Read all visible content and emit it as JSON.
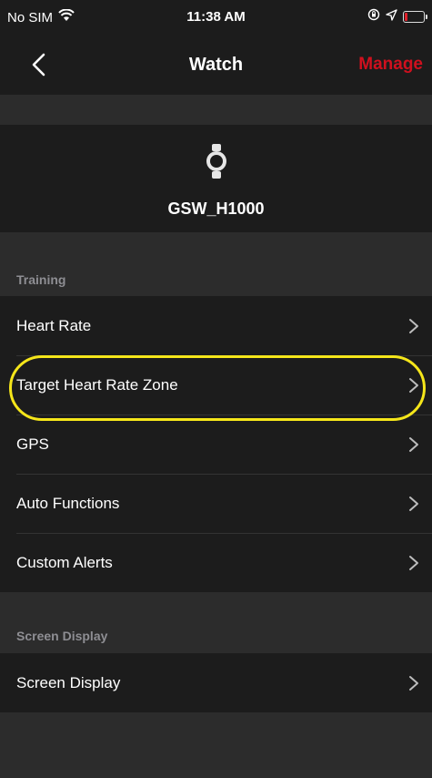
{
  "status_bar": {
    "carrier": "No SIM",
    "time": "11:38 AM",
    "icons": [
      "wifi-icon",
      "orientation-lock-icon",
      "location-arrow-icon",
      "battery-icon"
    ],
    "battery_color": "#e0202a"
  },
  "nav": {
    "back_icon": "chevron-left-icon",
    "title": "Watch",
    "manage_label": "Manage",
    "accent_color": "#d0101e"
  },
  "device": {
    "icon": "watch-icon",
    "name": "GSW_H1000"
  },
  "training": {
    "header": "Training",
    "items": [
      {
        "label": "Heart Rate"
      },
      {
        "label": "Target Heart Rate Zone",
        "highlighted": true
      },
      {
        "label": "GPS"
      },
      {
        "label": "Auto Functions"
      },
      {
        "label": "Custom Alerts"
      }
    ]
  },
  "screen_display": {
    "header": "Screen Display",
    "items": [
      {
        "label": "Screen Display"
      }
    ]
  },
  "highlight_color": "#f5e61a"
}
